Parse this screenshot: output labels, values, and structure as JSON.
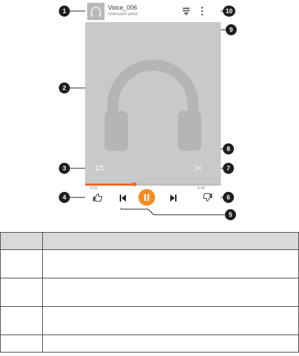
{
  "player": {
    "track_title": "Voice_006",
    "artist": "Unknown artist",
    "elapsed": "0:03",
    "duration": "0:09",
    "progress": 0.36
  },
  "icons": {
    "album_thumb": "headphones-icon",
    "queue": "playlist-icon",
    "more": "more-vert-icon",
    "album_art": "headphones-icon",
    "repeat": "repeat-icon",
    "shuffle": "shuffle-icon",
    "like": "thumbs-up-icon",
    "prev": "skip-previous-icon",
    "play_pause": "pause-icon",
    "next": "skip-next-icon",
    "dislike": "thumbs-down-icon"
  },
  "callouts": [
    "1",
    "2",
    "3",
    "4",
    "5",
    "6",
    "7",
    "8",
    "9",
    "10"
  ],
  "colors": {
    "accent": "#f26522",
    "play_button": "#f68b1f",
    "art_bg": "#c9c9c9",
    "callout": "#1f1f1f"
  },
  "legend_table": {
    "headers": [
      "",
      ""
    ],
    "rows": [
      [
        "",
        ""
      ],
      [
        "",
        ""
      ],
      [
        "",
        ""
      ],
      [
        "",
        ""
      ]
    ]
  }
}
